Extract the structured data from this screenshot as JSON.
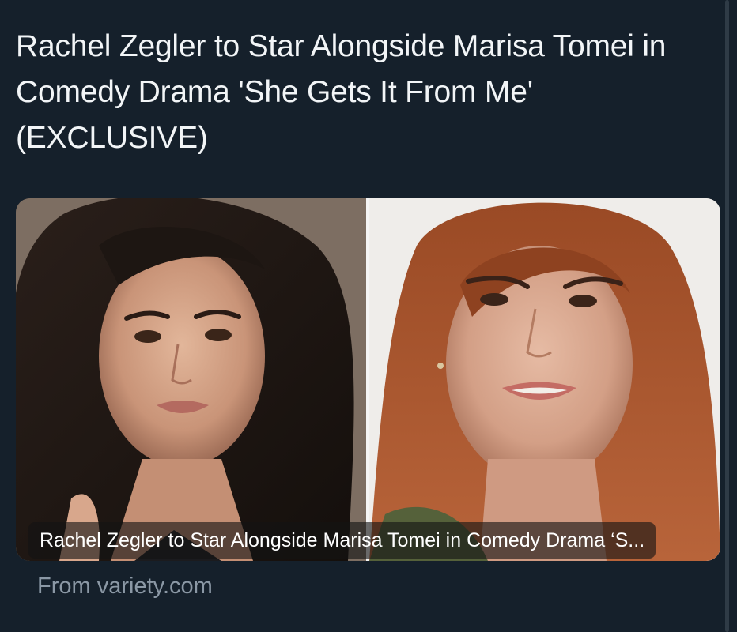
{
  "post": {
    "text": "Rachel Zegler to Star Alongside Marisa Tomei in Comedy Drama 'She Gets It From Me' (EXCLUSIVE)"
  },
  "link_card": {
    "image_caption": "Rachel Zegler to Star Alongside Marisa Tomei in Comedy Drama ‘S...",
    "source": "From variety.com"
  },
  "colors": {
    "background": "#15202b",
    "text_primary": "#f2f5f7",
    "text_secondary": "#8b98a5"
  }
}
